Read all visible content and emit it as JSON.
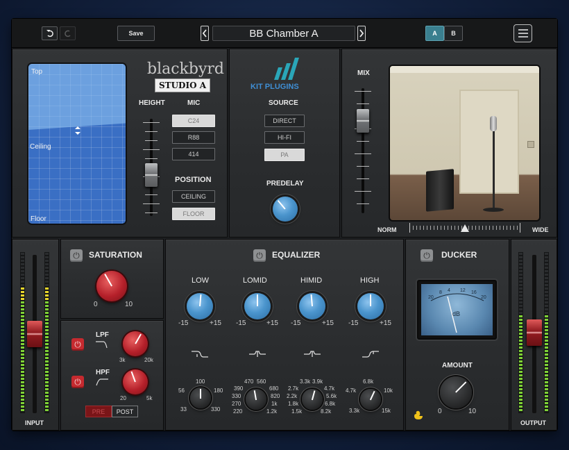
{
  "preset": {
    "name": "BB Chamber A"
  },
  "toolbar": {
    "save_label": "Save",
    "ab_a": "A",
    "ab_b": "B"
  },
  "room": {
    "pad_top_label": "Top",
    "pad_ceiling_label": "Ceiling",
    "pad_floor_label": "Floor",
    "logo_line1": "blackbyrd",
    "logo_line2": "STUDIO A",
    "height_label": "HEIGHT",
    "mic_label": "MIC",
    "mics": [
      "C24",
      "R88",
      "414"
    ],
    "selected_mic": "C24",
    "position_label": "POSITION",
    "positions": [
      "CEILING",
      "FLOOR"
    ],
    "selected_position": "FLOOR"
  },
  "source": {
    "brand": "KIT PLUGINS",
    "label": "SOURCE",
    "options": [
      "DIRECT",
      "HI-FI",
      "PA"
    ],
    "selected": "PA",
    "predelay_label": "PREDELAY"
  },
  "mix": {
    "label": "MIX",
    "norm_label": "NORM",
    "wide_label": "WIDE"
  },
  "input": {
    "label": "INPUT"
  },
  "output": {
    "label": "OUTPUT"
  },
  "saturation": {
    "label": "SATURATION",
    "min": "0",
    "max": "10"
  },
  "filters": {
    "lpf_label": "LPF",
    "lpf_min": "3k",
    "lpf_max": "20k",
    "hpf_label": "HPF",
    "hpf_min": "20",
    "hpf_max": "5k",
    "pre_label": "PRE",
    "post_label": "POST",
    "selected": "POST"
  },
  "equalizer": {
    "label": "EQUALIZER",
    "bands": [
      {
        "name": "LOW",
        "min": "-15",
        "max": "+15",
        "freqs": [
          "56",
          "100",
          "180",
          "33",
          "330"
        ]
      },
      {
        "name": "LOMID",
        "min": "-15",
        "max": "+15",
        "freqs": [
          "390",
          "470",
          "560",
          "330",
          "680",
          "270",
          "820",
          "220",
          "1k",
          "1.2k"
        ]
      },
      {
        "name": "HIMID",
        "min": "-15",
        "max": "+15",
        "freqs": [
          "2.7k",
          "3.3k",
          "3.9k",
          "4.7k",
          "2.2k",
          "5.6k",
          "1.8k",
          "6.8k",
          "1.5k",
          "8.2k"
        ]
      },
      {
        "name": "HIGH",
        "min": "-15",
        "max": "+15",
        "freqs": [
          "4.7k",
          "6.8k",
          "10k",
          "3.3k",
          "15k"
        ]
      }
    ]
  },
  "ducker": {
    "label": "DUCKER",
    "meter_scale": [
      "20",
      "8",
      "4",
      "12",
      "16",
      "20"
    ],
    "meter_unit": "dB",
    "amount_label": "AMOUNT",
    "amount_min": "0",
    "amount_max": "10"
  },
  "colors": {
    "accent_blue": "#4b95cd",
    "knob_red": "#b5202a",
    "meter_green": "#7fd335",
    "meter_yellow": "#e8d62a",
    "ab_active": "#3a7f8f"
  }
}
